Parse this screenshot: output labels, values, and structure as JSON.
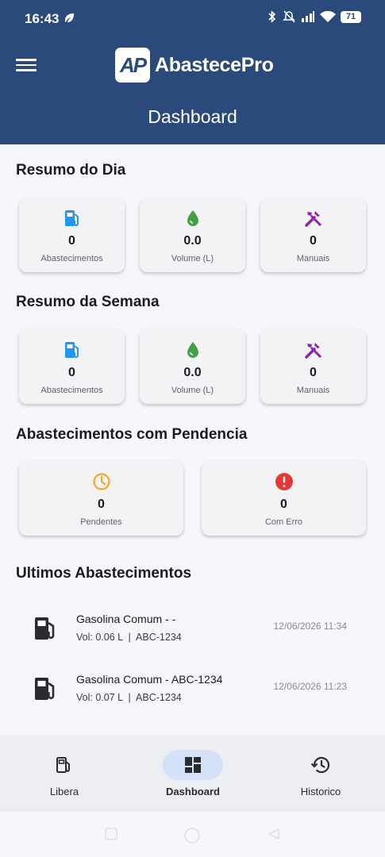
{
  "status_bar": {
    "time": "16:43",
    "battery": "71"
  },
  "header": {
    "logo_mark": "AP",
    "app_name": "AbastecePro",
    "title": "Dashboard"
  },
  "resumo_dia": {
    "title": "Resumo do Dia",
    "cards": [
      {
        "value": "0",
        "label": "Abastecimentos",
        "icon": "fuel-pump-icon",
        "color": "#2196f3"
      },
      {
        "value": "0.0",
        "label": "Volume (L)",
        "icon": "water-drop-icon",
        "color": "#43a047"
      },
      {
        "value": "0",
        "label": "Manuais",
        "icon": "tools-icon",
        "color": "#8e24aa"
      }
    ]
  },
  "resumo_semana": {
    "title": "Resumo da Semana",
    "cards": [
      {
        "value": "0",
        "label": "Abastecimentos",
        "icon": "fuel-pump-icon",
        "color": "#2196f3"
      },
      {
        "value": "0.0",
        "label": "Volume (L)",
        "icon": "water-drop-icon",
        "color": "#43a047"
      },
      {
        "value": "0",
        "label": "Manuais",
        "icon": "tools-icon",
        "color": "#8e24aa"
      }
    ]
  },
  "pendencias": {
    "title": "Abastecimentos com Pendencia",
    "cards": [
      {
        "value": "0",
        "label": "Pendentes",
        "icon": "clock-icon",
        "color": "#f5a623"
      },
      {
        "value": "0",
        "label": "Com Erro",
        "icon": "error-icon",
        "color": "#e53935"
      }
    ]
  },
  "ultimos": {
    "title": "Ultimos Abastecimentos",
    "items": [
      {
        "title": "Gasolina Comum - -",
        "subtitle": "Vol: 0.06 L  |  ABC-1234",
        "date": "12/06/2026 11:34"
      },
      {
        "title": "Gasolina Comum - ABC-1234",
        "subtitle": "Vol: 0.07 L  |  ABC-1234",
        "date": "12/06/2026 11:23"
      }
    ]
  },
  "bottom_nav": [
    {
      "label": "Libera",
      "icon": "fuel-pump-outline-icon",
      "active": false
    },
    {
      "label": "Dashboard",
      "icon": "dashboard-icon",
      "active": true
    },
    {
      "label": "Historico",
      "icon": "history-icon",
      "active": false
    }
  ],
  "colors": {
    "header": "#2b4a7c",
    "active_pill": "#d5e1f8"
  }
}
